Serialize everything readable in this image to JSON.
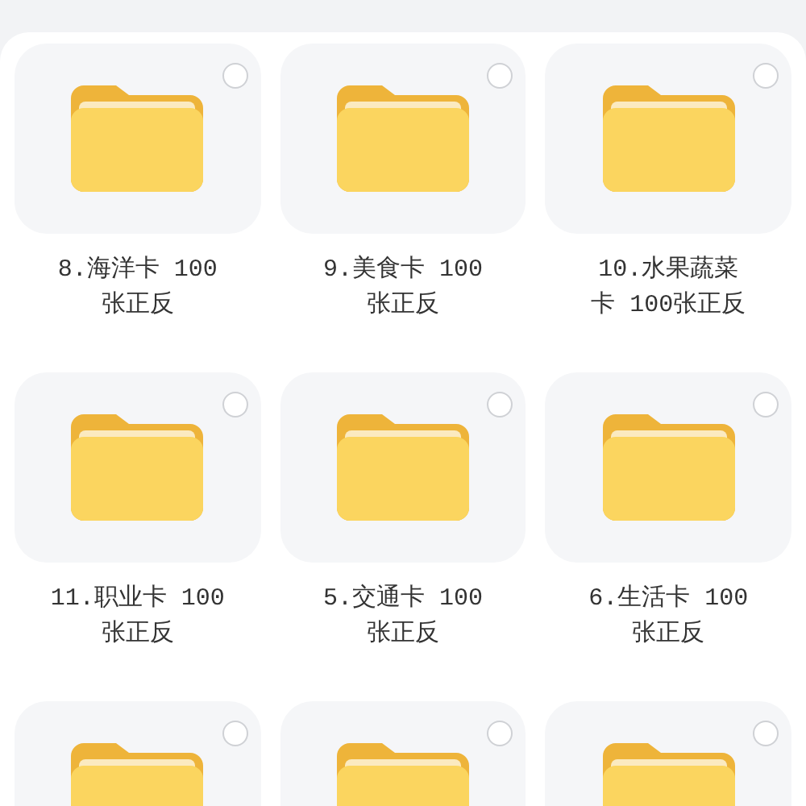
{
  "folders": [
    {
      "label_lines": [
        "8.海洋卡 100",
        "张正反"
      ],
      "selected": false
    },
    {
      "label_lines": [
        "9.美食卡 100",
        "张正反"
      ],
      "selected": false
    },
    {
      "label_lines": [
        "10.水果蔬菜",
        "卡 100张正反"
      ],
      "selected": false
    },
    {
      "label_lines": [
        "11.职业卡 100",
        "张正反"
      ],
      "selected": false
    },
    {
      "label_lines": [
        "5.交通卡 100",
        "张正反"
      ],
      "selected": false
    },
    {
      "label_lines": [
        "6.生活卡 100",
        "张正反"
      ],
      "selected": false
    },
    {
      "selected": false
    },
    {
      "selected": false
    },
    {
      "selected": false
    }
  ]
}
